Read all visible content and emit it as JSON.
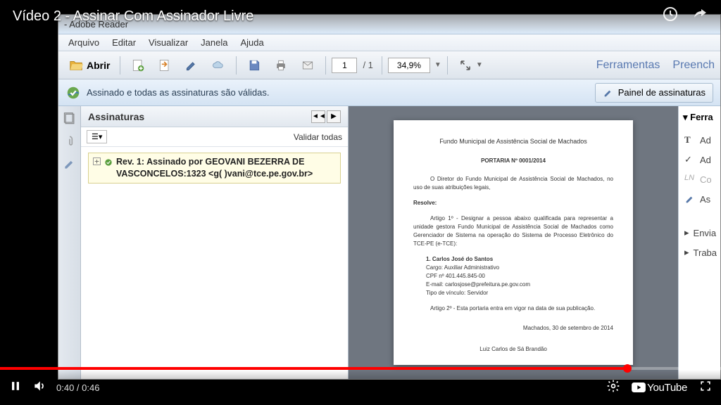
{
  "video": {
    "title": "Vídeo 2 - Assinar Com Assinador Livre",
    "current_time": "0:40",
    "duration": "0:46",
    "brand": "YouTube"
  },
  "reader": {
    "window_title": " - Adobe Reader",
    "menu": [
      "Arquivo",
      "Editar",
      "Visualizar",
      "Janela",
      "Ajuda"
    ],
    "toolbar": {
      "open_label": "Abrir",
      "page_current": "1",
      "page_total": "/ 1",
      "zoom": "34,9%",
      "tools_label": "Ferramentas",
      "fill_label": "Preench"
    },
    "sig_banner": {
      "message": "Assinado e todas as assinaturas são válidas.",
      "panel_btn": "Painel de assinaturas"
    },
    "sig_panel": {
      "title": "Assinaturas",
      "validate_all": "Validar todas",
      "entry": "Rev. 1: Assinado por GEOVANI BEZERRA DE VASCONCELOS:1323 <g( )vani@tce.pe.gov.br>"
    },
    "right_panel": {
      "title": "▾  Ferra",
      "items": [
        "Ad",
        "Ad",
        "Co",
        "As"
      ],
      "sections": [
        "Envia",
        "Traba"
      ]
    }
  },
  "document": {
    "header": "Fundo Municipal de Assistência Social de Machados",
    "portaria": "PORTARIA Nº 0001/2014",
    "intro": "O Diretor do Fundo Municipal de Assistência Social de Machados, no uso de suas atribuições legais,",
    "resolve": "Resolve:",
    "art1": "Artigo 1º - Designar a pessoa abaixo qualificada para representar a unidade gestora Fundo Municipal de Assistência Social de Machados como Gerenciador de Sistema na operação do Sistema de Processo Eletrônico do TCE-PE (e-TCE):",
    "person_name": "1. Carlos José do Santos",
    "person_cargo": "Cargo: Auxiliar Administrativo",
    "person_cpf": "CPF nº 401.445.845-00",
    "person_email": "E-mail: carlosjose@prefeitura.pe.gov.com",
    "person_vinculo": "Tipo de vínculo: Servidor",
    "art2": "Artigo 2º - Esta portaria entra em vigor na data de sua publicação.",
    "local_data": "Machados, 30 de setembro de 2014",
    "signer": "Luiz Carlos de Sá Brandão"
  }
}
